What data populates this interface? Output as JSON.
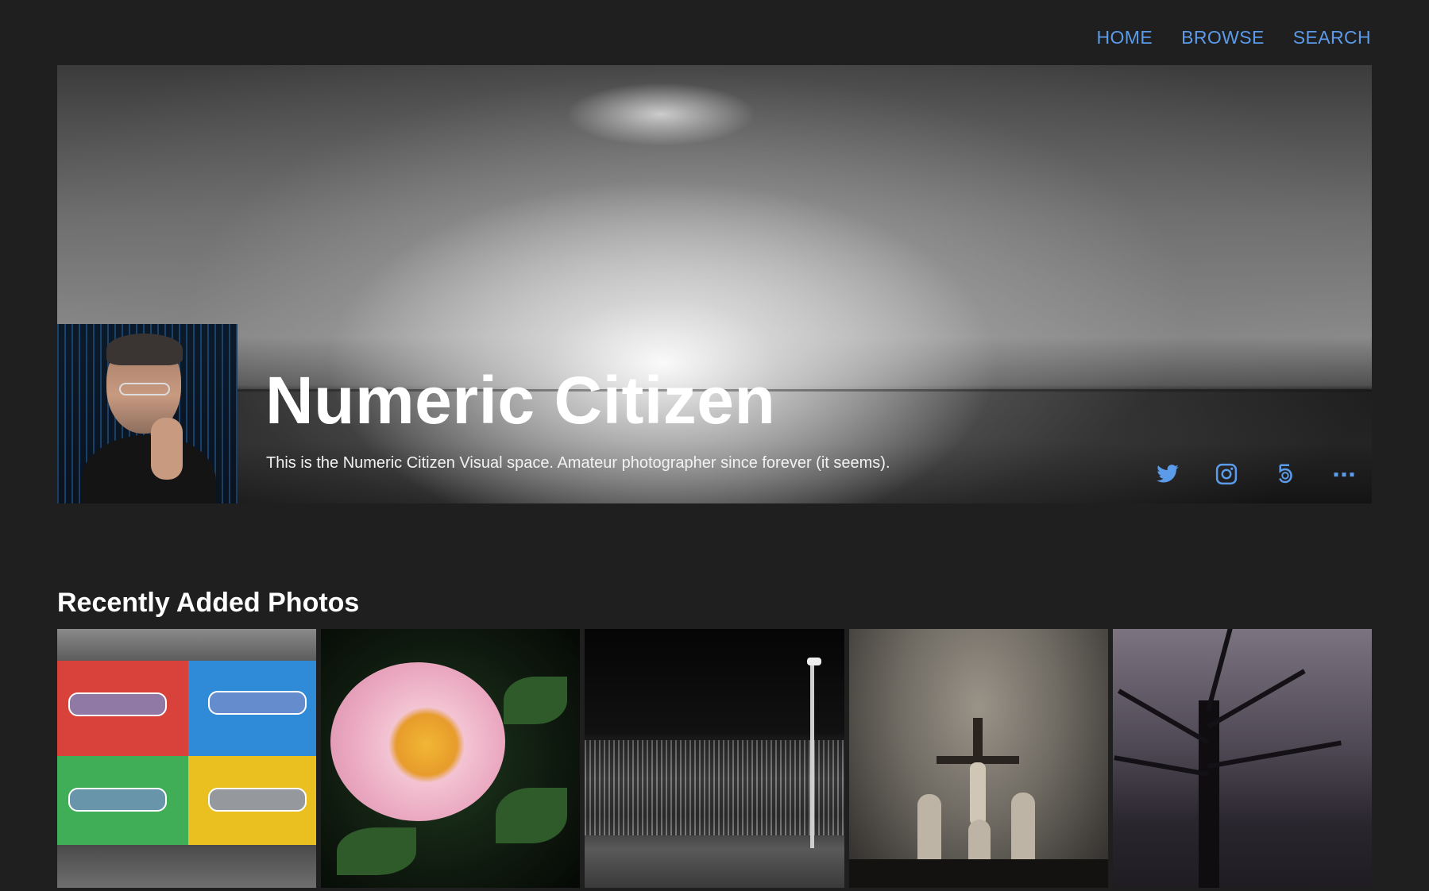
{
  "nav": {
    "items": [
      "HOME",
      "BROWSE",
      "SEARCH"
    ]
  },
  "hero": {
    "title": "Numeric Citizen",
    "subtitle": "This is the Numeric Citizen Visual space. Amateur photographer since forever (it seems).",
    "social_icons": [
      "twitter-icon",
      "instagram-icon",
      "500px-icon",
      "more-icon"
    ]
  },
  "section": {
    "title": "Recently Added Photos"
  },
  "photos": [
    {
      "subject": "graffiti-wall"
    },
    {
      "subject": "peony-flower"
    },
    {
      "subject": "night-trees-lamppost"
    },
    {
      "subject": "crucifix-statues"
    },
    {
      "subject": "bare-tree"
    }
  ],
  "colors": {
    "background": "#1f1f1f",
    "accent": "#5b9bea",
    "text": "#ffffff"
  }
}
